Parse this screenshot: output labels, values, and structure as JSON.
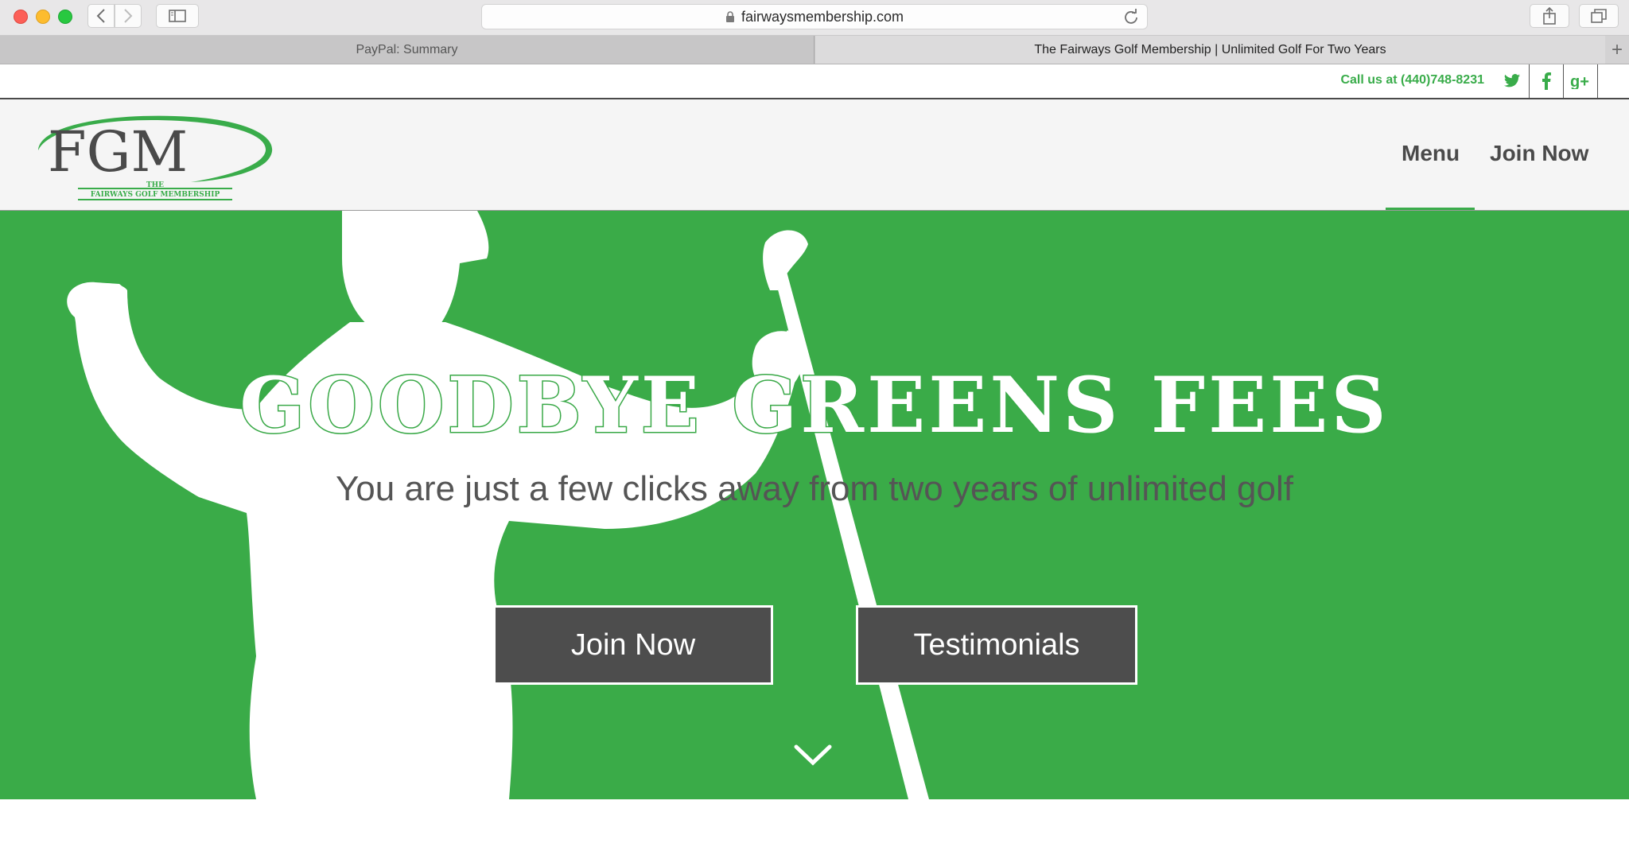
{
  "browser": {
    "url": "fairwaysmembership.com",
    "tabs": [
      {
        "label": "PayPal: Summary",
        "active": false
      },
      {
        "label": "The Fairways Golf Membership | Unlimited Golf For Two Years",
        "active": true
      }
    ],
    "new_tab_label": "+"
  },
  "topbar": {
    "call_text": "Call us at (440)748-8231",
    "social_icons": [
      "twitter-icon",
      "facebook-icon",
      "google-plus-icon"
    ]
  },
  "header": {
    "logo_letters": "FGM",
    "logo_caption_top": "THE",
    "logo_caption_bottom": "FAIRWAYS GOLF MEMBERSHIP",
    "nav": [
      {
        "label": "Menu",
        "active": true
      },
      {
        "label": "Join Now",
        "active": false
      }
    ]
  },
  "hero": {
    "headline": "GOODBYE GREENS FEES",
    "subhead": "You are just a few clicks away from two years of unlimited golf",
    "buttons": [
      {
        "label": "Join Now"
      },
      {
        "label": "Testimonials"
      }
    ],
    "scroll_icon": "chevron-down-icon"
  },
  "colors": {
    "brand_green": "#3aab48",
    "button_gray": "#4d4d4d",
    "text_gray": "#4a4a4a"
  }
}
